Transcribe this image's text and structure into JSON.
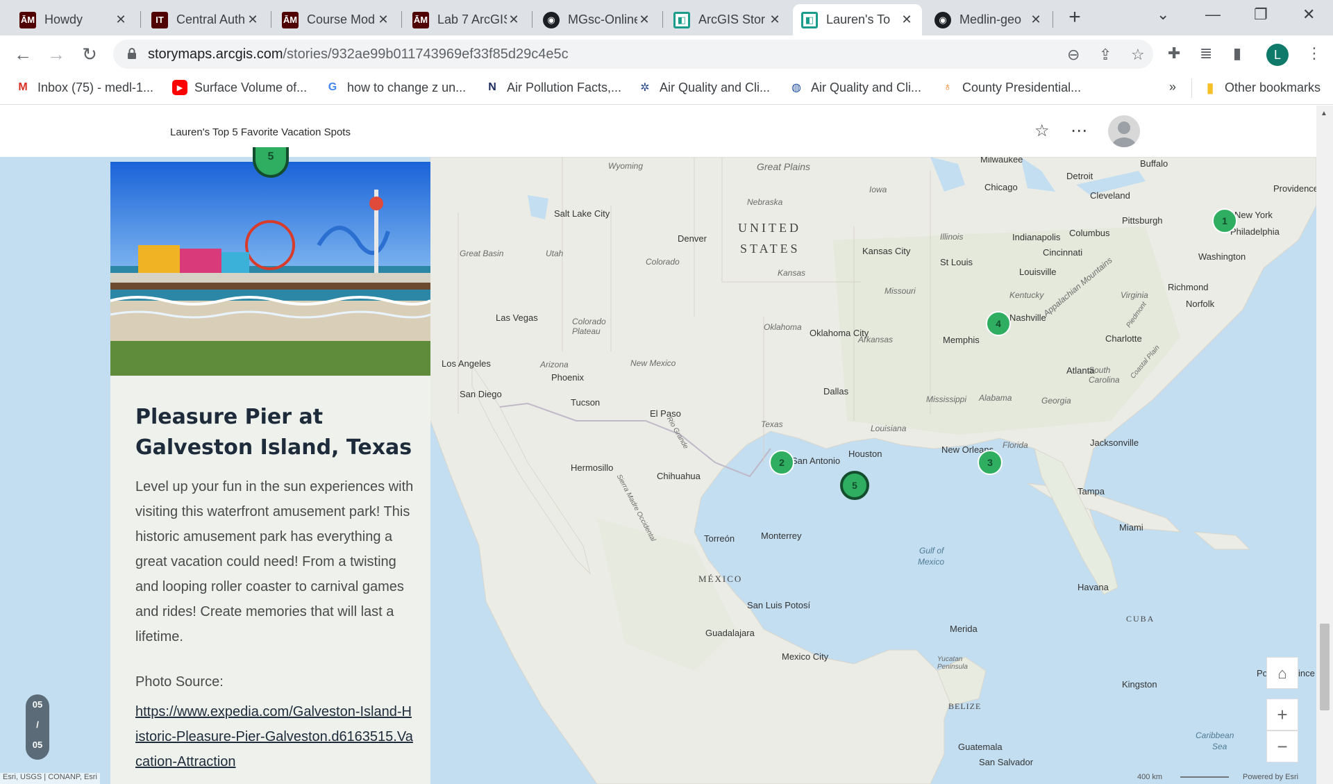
{
  "browser": {
    "tabs": [
      {
        "title": "Howdy",
        "icon": "tamu-icon"
      },
      {
        "title": "Central Auth",
        "icon": "it-icon"
      },
      {
        "title": "Course Mod",
        "icon": "tamu-icon"
      },
      {
        "title": "Lab 7 ArcGIS",
        "icon": "tamu-icon"
      },
      {
        "title": "MGsc-Online",
        "icon": "github-icon"
      },
      {
        "title": "ArcGIS Stor",
        "icon": "storymaps-icon"
      },
      {
        "title": "Lauren's To",
        "icon": "storymaps-icon"
      },
      {
        "title": "Medlin-geo",
        "icon": "github-icon"
      }
    ],
    "active_tab_index": 6,
    "url_host": "storymaps.arcgis.com",
    "url_path": "/stories/932ae99b011743969ef33f85d29c4e5c",
    "profile_initial": "L",
    "bookmarks": [
      {
        "label": "Inbox (75) - medl-1...",
        "icon": "gmail-icon"
      },
      {
        "label": "Surface Volume of...",
        "icon": "youtube-icon"
      },
      {
        "label": "how to change z un...",
        "icon": "google-icon"
      },
      {
        "label": "Air Pollution Facts,...",
        "icon": "n-icon"
      },
      {
        "label": "Air Quality and Cli...",
        "icon": "snowflake-icon"
      },
      {
        "label": "Air Quality and Cli...",
        "icon": "globe-icon"
      },
      {
        "label": "County Presidential...",
        "icon": "location-icon"
      }
    ],
    "bookmarks_overflow": "»",
    "other_bookmarks": "Other bookmarks"
  },
  "story": {
    "title": "Lauren's Top 5 Favorite Vacation Spots"
  },
  "card": {
    "marker_number": "5",
    "heading": "Pleasure Pier at Galveston Island, Texas",
    "body": "Level up your fun in the sun experiences with visiting this waterfront amusement park! This historic amusement park has everything a great vacation could need! From a twisting and looping roller coaster to carnival games and rides! Create memories that will last a lifetime.",
    "photo_label": "Photo Source:",
    "photo_link": "https://www.expedia.com/Galveston-Island-Historic-Pleasure-Pier-Galveston.d6163515.Vacation-Attraction"
  },
  "progress": {
    "current": "05",
    "sep": "/",
    "total": "05"
  },
  "map": {
    "country_labels": [
      "UNITED",
      "STATES",
      "MÉXICO",
      "CUBA",
      "BELIZE"
    ],
    "water_labels": [
      "Gulf of",
      "Mexico",
      "Caribbean",
      "Sea"
    ],
    "region_labels": [
      "Great Plains",
      "Great Basin",
      "Colorado Plateau",
      "Appalachian Mountains",
      "Sierra Madre Occidental",
      "Piedmont",
      "Coastal Plain",
      "Yucatan Peninsula",
      "Rio Grande"
    ],
    "state_labels": [
      "Wyoming",
      "Nebraska",
      "Iowa",
      "Kansas",
      "Missouri",
      "Illinois",
      "Utah",
      "Colorado",
      "Arizona",
      "New Mexico",
      "Oklahoma",
      "Texas",
      "Arkansas",
      "Louisiana",
      "Mississippi",
      "Alabama",
      "Georgia",
      "Florida",
      "Kentucky",
      "Virginia",
      "South Carolina"
    ],
    "cities": [
      "Milwaukee",
      "Chicago",
      "Detroit",
      "Buffalo",
      "Cleveland",
      "Providence",
      "New York",
      "Philadelphia",
      "Pittsburgh",
      "Columbus",
      "Indianapolis",
      "Cincinnati",
      "Washington",
      "Salt Lake City",
      "Denver",
      "Kansas City",
      "St Louis",
      "Louisville",
      "Richmond",
      "Norfolk",
      "Nashville",
      "Las Vegas",
      "Oklahoma City",
      "Memphis",
      "Charlotte",
      "Los Angeles",
      "Phoenix",
      "Atlanta",
      "San Diego",
      "Dallas",
      "Tucson",
      "El Paso",
      "San Antonio",
      "Houston",
      "New Orleans",
      "Jacksonville",
      "Hermosillo",
      "Chihuahua",
      "Tampa",
      "Torreón",
      "Monterrey",
      "Miami",
      "Havana",
      "San Luis Potosí",
      "Guadalajara",
      "Mexico City",
      "Merida",
      "Kingston",
      "Port-au-Prince",
      "Guatemala",
      "San Salvador"
    ],
    "markers": [
      {
        "id": "1",
        "active": false
      },
      {
        "id": "2",
        "active": false
      },
      {
        "id": "3",
        "active": false
      },
      {
        "id": "4",
        "active": false
      },
      {
        "id": "5",
        "active": true
      }
    ],
    "attribution": "Esri, USGS | CONANP, Esri",
    "scale_label": "400 km",
    "powered_by": "Powered by Esri"
  }
}
